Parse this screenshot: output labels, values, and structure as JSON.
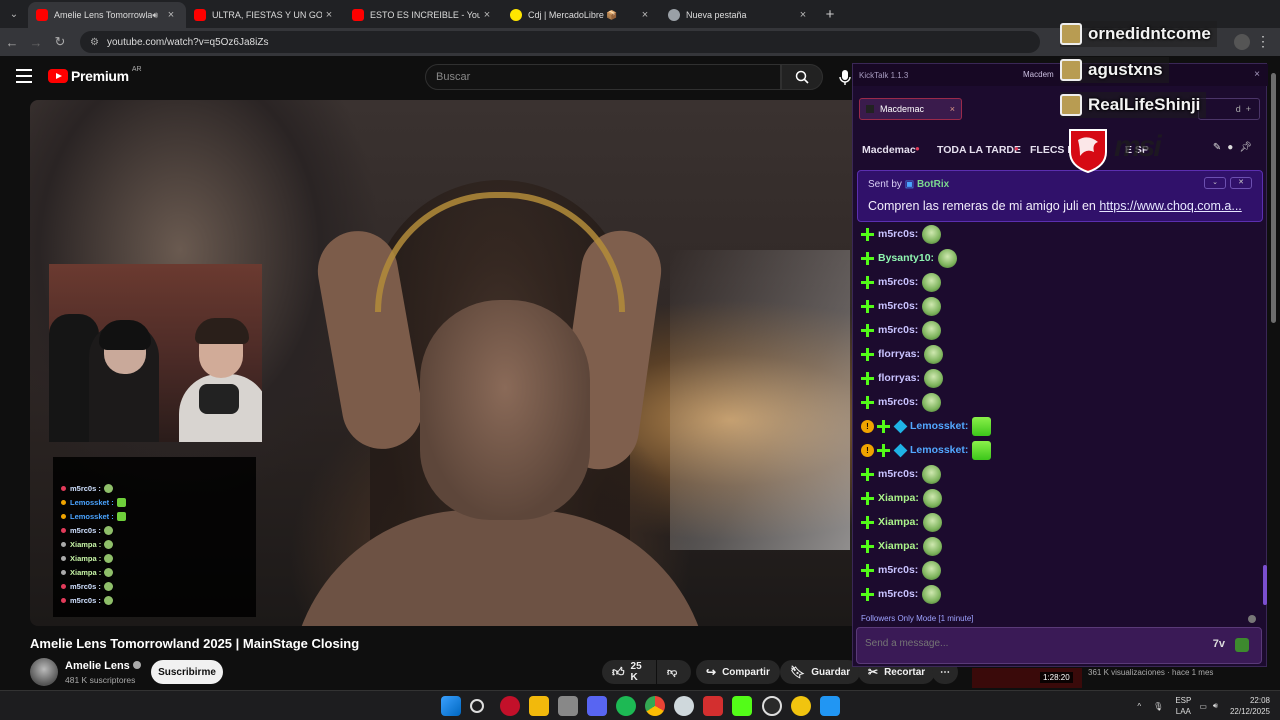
{
  "browser": {
    "tabs": [
      {
        "title": "Amelie Lens Tomorrowland",
        "icon": "youtube-icon",
        "active": true
      },
      {
        "title": "ULTRA, FIESTAS Y UN GORDO L",
        "icon": "youtube-icon"
      },
      {
        "title": "ESTO ES INCREIBLE - YouTube",
        "icon": "youtube-icon"
      },
      {
        "title": "Cdj | MercadoLibre 📦",
        "icon": "mercadolibre-icon"
      },
      {
        "title": "Nueva pestaña",
        "icon": "globe-icon"
      }
    ],
    "url": "youtube.com/watch?v=q5Oz6Ja8iZs"
  },
  "youtube": {
    "logo_text": "Premium",
    "country": "AR",
    "search_placeholder": "Buscar",
    "video_title": "Amelie Lens Tomorrowland 2025 | MainStage Closing",
    "channel_name": "Amelie Lens",
    "subscribers": "481 K suscriptores",
    "subscribe_label": "Suscribirme",
    "likes": "25 K",
    "share_label": "Compartir",
    "save_label": "Guardar",
    "clip_label": "Recortar",
    "rec_views": "361 K visualizaciones · hace 1 mes",
    "rec_duration": "1:28:20"
  },
  "overlay_chat": [
    {
      "user": "m5rc0s :",
      "color": "#cfe0ff",
      "badge": "#e23b5a",
      "emote": "frog"
    },
    {
      "user": "Lemossket :",
      "color": "#4aa3ff",
      "badge": "#f0a400",
      "emote": "pickle"
    },
    {
      "user": "Lemossket :",
      "color": "#4aa3ff",
      "badge": "#f0a400",
      "emote": "pickle"
    },
    {
      "user": "m5rc0s :",
      "color": "#cfe0ff",
      "badge": "#e23b5a",
      "emote": "frog"
    },
    {
      "user": "Xiampa :",
      "color": "#c9f7a8",
      "badge": "#aaaaaa",
      "emote": "frog"
    },
    {
      "user": "Xiampa :",
      "color": "#c9f7a8",
      "badge": "#aaaaaa",
      "emote": "frog"
    },
    {
      "user": "Xiampa :",
      "color": "#c9f7a8",
      "badge": "#aaaaaa",
      "emote": "frog"
    },
    {
      "user": "m5rc0s :",
      "color": "#cfe0ff",
      "badge": "#e23b5a",
      "emote": "frog"
    },
    {
      "user": "m5rc0s :",
      "color": "#cfe0ff",
      "badge": "#e23b5a",
      "emote": "frog"
    }
  ],
  "kicktalk": {
    "app_title": "KickTalk 1.1.3",
    "window_label": "Macdem",
    "chat_tab": "Macdemac",
    "add_label": "d",
    "mentions": [
      "Macdemac",
      "TODA LA TARDE",
      "FLECS D",
      "E SP"
    ],
    "pinned_by": "Sent by",
    "pinned_bot": "BotRix",
    "pinned_message": "Compren las remeras de mi amigo juli en ",
    "pinned_link": "https://www.choq.com.a...",
    "messages": [
      {
        "user": "m5rc0s:",
        "color": "#c9c3ff",
        "badges": [],
        "emote": "frog"
      },
      {
        "user": "Bysanty10:",
        "color": "#8ff5b0",
        "badges": [],
        "emote": "frog"
      },
      {
        "user": "m5rc0s:",
        "color": "#c9c3ff",
        "badges": [],
        "emote": "frog"
      },
      {
        "user": "m5rc0s:",
        "color": "#c9c3ff",
        "badges": [],
        "emote": "frog"
      },
      {
        "user": "m5rc0s:",
        "color": "#c9c3ff",
        "badges": [],
        "emote": "frog"
      },
      {
        "user": "florryas:",
        "color": "#c9c3ff",
        "badges": [],
        "emote": "frog"
      },
      {
        "user": "florryas:",
        "color": "#c9c3ff",
        "badges": [],
        "emote": "frog"
      },
      {
        "user": "m5rc0s:",
        "color": "#c9c3ff",
        "badges": [],
        "emote": "frog"
      },
      {
        "user": "Lemossket:",
        "color": "#52a8ff",
        "badges": [
          "tier",
          "diamond"
        ],
        "emote": "pickle"
      },
      {
        "user": "Lemossket:",
        "color": "#52a8ff",
        "badges": [
          "tier",
          "diamond"
        ],
        "emote": "pickle"
      },
      {
        "user": "m5rc0s:",
        "color": "#c9c3ff",
        "badges": [],
        "emote": "frog"
      },
      {
        "user": "Xiampa:",
        "color": "#aaf28a",
        "badges": [],
        "emote": "frog"
      },
      {
        "user": "Xiampa:",
        "color": "#aaf28a",
        "badges": [],
        "emote": "frog"
      },
      {
        "user": "Xiampa:",
        "color": "#aaf28a",
        "badges": [],
        "emote": "frog"
      },
      {
        "user": "m5rc0s:",
        "color": "#c9c3ff",
        "badges": [],
        "emote": "frog"
      },
      {
        "user": "m5rc0s:",
        "color": "#c9c3ff",
        "badges": [],
        "emote": "frog"
      }
    ],
    "mode_text": "Followers Only Mode [1 minute]",
    "send_placeholder": "Send a message..."
  },
  "stream_overlay": {
    "names": [
      "ornedidntcome",
      "agustxns",
      "RealLifeShinji"
    ],
    "sponsor": "msi"
  },
  "taskbar": {
    "lang_top": "ESP",
    "lang_bottom": "LAA",
    "time": "22:08",
    "date": "22/12/2025"
  }
}
